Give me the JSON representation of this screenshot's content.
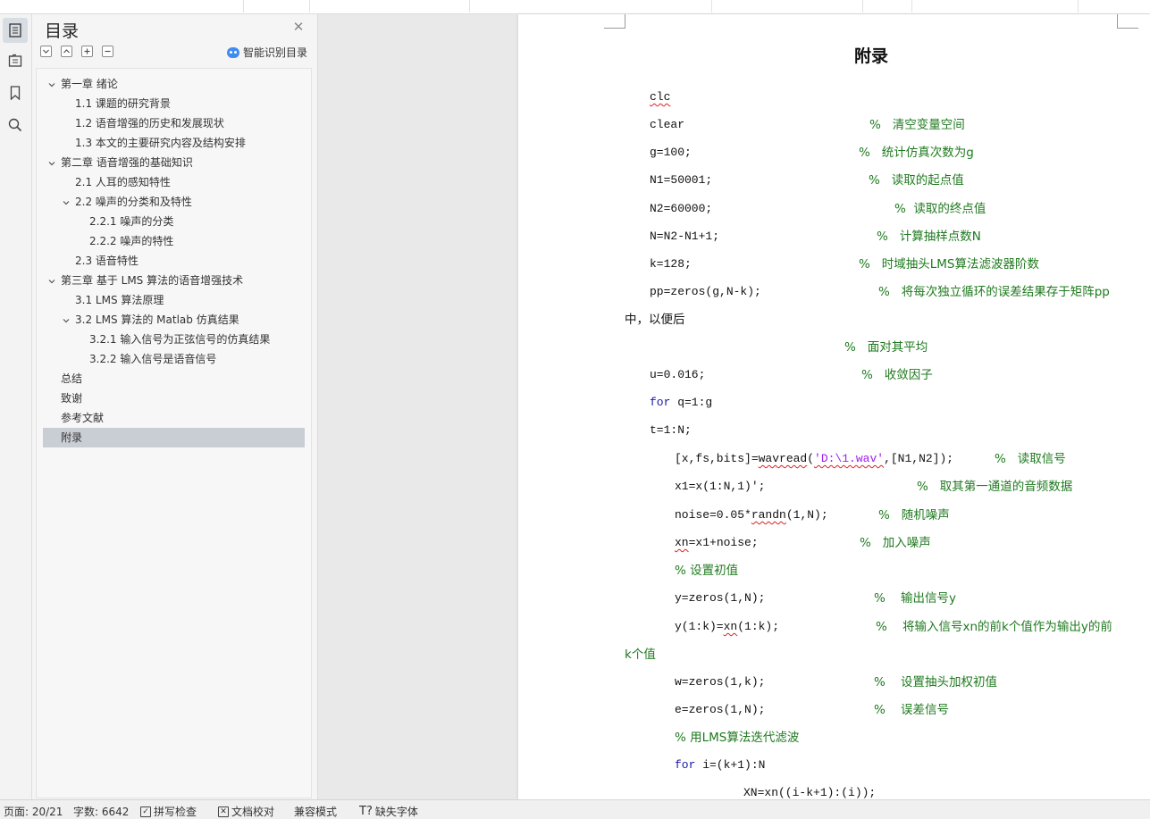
{
  "toc": {
    "title": "目录",
    "smart_label": "智能识别目录",
    "items": [
      {
        "label": "第一章  绪论",
        "level": 1,
        "expanded": true
      },
      {
        "label": "1.1  课题的研究背景",
        "level": 2
      },
      {
        "label": "1.2  语音增强的历史和发展现状",
        "level": 2
      },
      {
        "label": "1.3  本文的主要研究内容及结构安排",
        "level": 2
      },
      {
        "label": "第二章  语音增强的基础知识",
        "level": 1,
        "expanded": true
      },
      {
        "label": "2.1  人耳的感知特性",
        "level": 2
      },
      {
        "label": "2.2  噪声的分类和及特性",
        "level": 2,
        "expanded": true
      },
      {
        "label": "2.2.1  噪声的分类",
        "level": 3
      },
      {
        "label": "2.2.2  噪声的特性",
        "level": 3
      },
      {
        "label": "2.3 语音特性",
        "level": 2
      },
      {
        "label": "第三章  基于 LMS 算法的语音增强技术",
        "level": 1,
        "expanded": true
      },
      {
        "label": "3.1 LMS 算法原理",
        "level": 2
      },
      {
        "label": "3.2 LMS 算法的 Matlab 仿真结果",
        "level": 2,
        "expanded": true
      },
      {
        "label": "3.2.1  输入信号为正弦信号的仿真结果",
        "level": 3
      },
      {
        "label": "3.2.2  输入信号是语音信号",
        "level": 3
      },
      {
        "label": "总结",
        "level": 1
      },
      {
        "label": "致谢",
        "level": 1
      },
      {
        "label": "参考文献",
        "level": 1
      },
      {
        "label": "附录",
        "level": 1,
        "selected": true
      }
    ]
  },
  "document": {
    "title": "附录",
    "lines": {
      "l1": "clc",
      "l2": "clear",
      "c2": "%   清空变量空间",
      "l3": "g=100;",
      "c3": "%   统计仿真次数为g",
      "l4": "N1=50001;",
      "c4": "%   读取的起点值",
      "l5": "N2=60000;",
      "c5": "%  读取的终点值",
      "l6": "N=N2-N1+1;",
      "c6": "%   计算抽样点数N",
      "l7": "k=128;",
      "c7": "%   时域抽头LMS算法滤波器阶数",
      "l8": "pp=zeros(g,N-k);",
      "c8": "%   将每次独立循环的误差结果存于矩阵pp",
      "c8b": "中，以便后",
      "c8c": "%   面对其平均",
      "l9": "u=0.016;",
      "c9": "%   收敛因子",
      "l10a": "for",
      "l10b": " q=1:g",
      "l11": "t=1:N;",
      "l12a": "[x,fs,bits]=",
      "l12b": "wavread",
      "l12c": "(",
      "l12d": "'D:\\1.wav'",
      "l12e": ",[N1,N2]);",
      "c12": "%   读取信号",
      "l13": "x1=x(1:N,1)';",
      "c13": "%   取其第一通道的音频数据",
      "l14a": "noise=0.05*",
      "l14b": "randn",
      "l14c": "(1,N);",
      "c14": "%   随机噪声",
      "l15a": "xn",
      "l15b": "=x1+noise;",
      "c15": "%   加入噪声",
      "c16": "% 设置初值",
      "l17": "y=zeros(1,N);",
      "c17": "%    输出信号y",
      "l18a": "y(1:k)=",
      "l18b": "xn",
      "l18c": "(1:k);",
      "c18": "%    将输入信号xn的前k个值作为输出y的前",
      "c18b": "k个值",
      "l19": "w=zeros(1,k);",
      "c19": "%    设置抽头加权初值",
      "l20": "e=zeros(1,N);",
      "c20": "%    误差信号",
      "c21": "% 用LMS算法迭代滤波",
      "l22a": "for",
      "l22b": " i=(k+1):N",
      "l23": "XN=xn((i-k+1):(i));"
    }
  },
  "status": {
    "page": "页面: 20/21",
    "words": "字数: 6642",
    "spell": "拼写检查",
    "proof": "文档校对",
    "compat": "兼容模式",
    "missing_font": "缺失字体"
  }
}
